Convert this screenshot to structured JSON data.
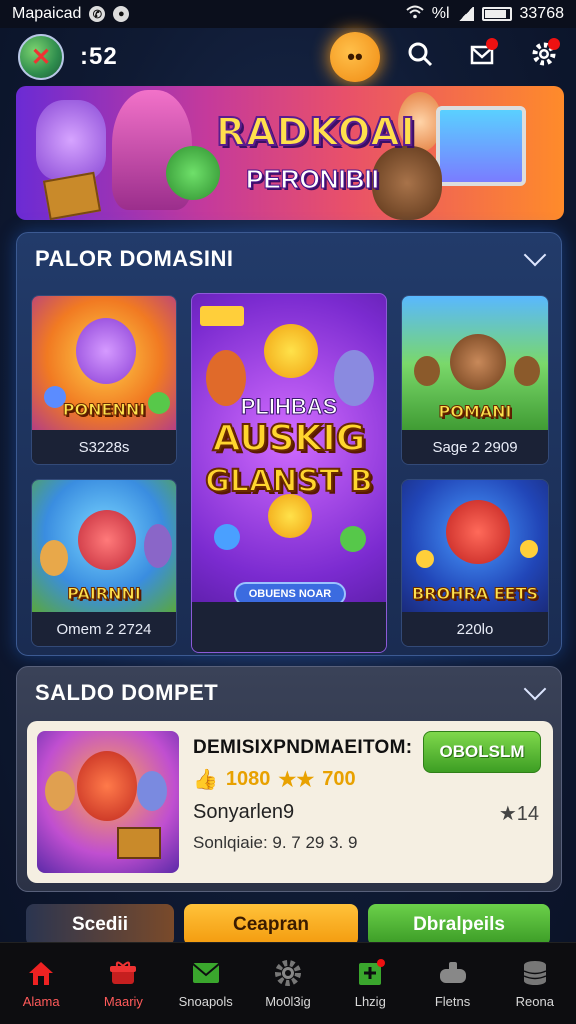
{
  "status_bar": {
    "carrier": "Mapaicad",
    "signal_text": "%l",
    "time": "33768"
  },
  "header": {
    "coin_count": ":52",
    "center_icon": "smiley-coin-icon",
    "icons": [
      "search-icon",
      "mail-icon",
      "gear-icon"
    ]
  },
  "banner": {
    "title": "RADKOAI",
    "subtitle": "PERONIBII"
  },
  "section1": {
    "title": "PALOR DOMASINI",
    "cards": [
      {
        "art_label": "PONENNI",
        "caption": "S3228s"
      },
      {
        "art_label": "POMANI",
        "caption": "Sage 2 2909"
      },
      {
        "art_label": "PAIRNNI",
        "caption": "Omem 2 2724"
      },
      {
        "art_label": "BROHRA EETS",
        "caption": "220lo"
      }
    ],
    "featured": {
      "line1": "PLIHBAS",
      "line2": "AUSKIG",
      "line3": "GLANST B",
      "pill": "OBUENS NOAR"
    }
  },
  "section2": {
    "title": "SALDO DOMPET",
    "item": {
      "title": "DEMISIXPNDMAEITOM:",
      "score1": "1080",
      "score2": "700",
      "name": "Sonyarlen9",
      "detail": "Sonlqiaie: 9. 7 29 3. 9",
      "rating": "14",
      "button": "OBOLSLM"
    }
  },
  "actions": {
    "left": "Scedii",
    "middle": "Ceapran",
    "right": "Dbralpeils"
  },
  "nav": [
    {
      "label": "Alama",
      "icon": "home-icon"
    },
    {
      "label": "Maariy",
      "icon": "gift-icon"
    },
    {
      "label": "Snoapols",
      "icon": "mail-icon"
    },
    {
      "label": "Mo0l3ig",
      "icon": "gear-icon"
    },
    {
      "label": "Lhzig",
      "icon": "tasks-icon"
    },
    {
      "label": "Fletns",
      "icon": "controller-icon"
    },
    {
      "label": "Reona",
      "icon": "database-icon"
    }
  ],
  "colors": {
    "accent_orange": "#f39a0d",
    "accent_green": "#3d9e24",
    "panel_blue": "#223b6a",
    "nav_active": "#ff5a5a"
  }
}
